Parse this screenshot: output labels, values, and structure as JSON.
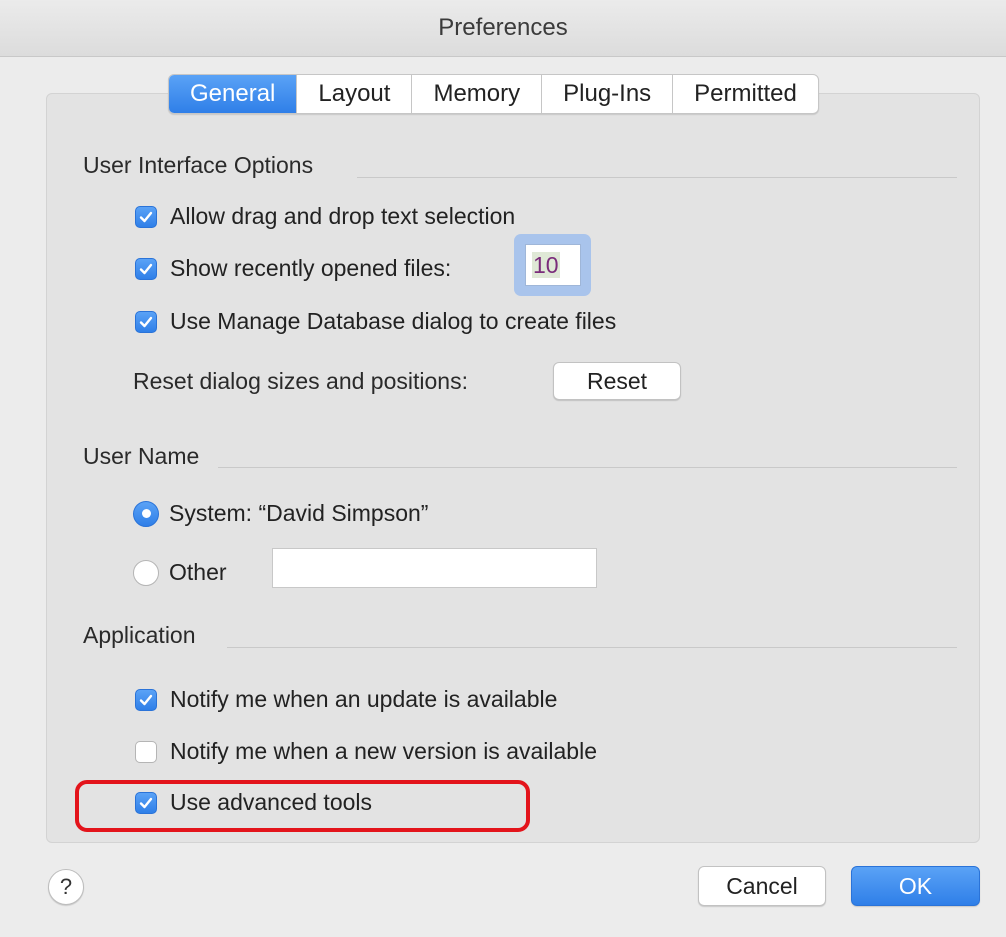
{
  "window": {
    "title": "Preferences"
  },
  "tabs": [
    {
      "label": "General",
      "active": true
    },
    {
      "label": "Layout",
      "active": false
    },
    {
      "label": "Memory",
      "active": false
    },
    {
      "label": "Plug-Ins",
      "active": false
    },
    {
      "label": "Permitted",
      "active": false
    }
  ],
  "ui_options": {
    "heading": "User Interface Options",
    "drag_drop": {
      "label": "Allow drag and drop text selection",
      "checked": true
    },
    "recent_files": {
      "label": "Show recently opened files:",
      "checked": true,
      "count": "10"
    },
    "manage_db": {
      "label": "Use Manage Database dialog to create files",
      "checked": true
    },
    "reset": {
      "label": "Reset dialog sizes and positions:",
      "button": "Reset"
    }
  },
  "user_name": {
    "heading": "User Name",
    "system": {
      "label": "System: “David Simpson”",
      "selected": true
    },
    "other": {
      "label": "Other",
      "selected": false,
      "value": ""
    }
  },
  "application": {
    "heading": "Application",
    "notify_update": {
      "label": "Notify me when an update is available",
      "checked": true
    },
    "notify_version": {
      "label": "Notify me when a new version is available",
      "checked": false
    },
    "advanced_tools": {
      "label": "Use advanced tools",
      "checked": true
    }
  },
  "footer": {
    "help": "?",
    "cancel": "Cancel",
    "ok": "OK"
  },
  "colors": {
    "accent": "#2f7fe8",
    "highlight": "#e3141b",
    "background": "#ececec"
  }
}
